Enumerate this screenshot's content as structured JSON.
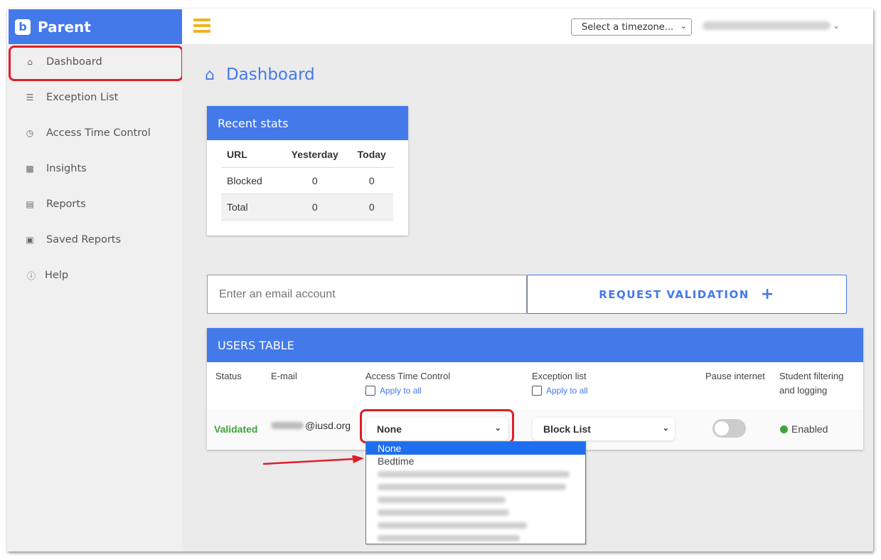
{
  "brand": {
    "logo": "b",
    "name": "Parent"
  },
  "sidebar": {
    "items": [
      {
        "label": "Dashboard",
        "icon": "home-icon"
      },
      {
        "label": "Exception List",
        "icon": "list-icon"
      },
      {
        "label": "Access Time Control",
        "icon": "clock-icon"
      },
      {
        "label": "Insights",
        "icon": "bar-chart-icon"
      },
      {
        "label": "Reports",
        "icon": "document-icon"
      },
      {
        "label": "Saved Reports",
        "icon": "saved-document-icon"
      },
      {
        "label": "Help",
        "icon": "question-circle-icon"
      }
    ]
  },
  "topbar": {
    "timezone_select": "Select a timezone..."
  },
  "page": {
    "title": "Dashboard"
  },
  "stats": {
    "title": "Recent stats",
    "headers": [
      "URL",
      "Yesterday",
      "Today"
    ],
    "rows": [
      [
        "Blocked",
        "0",
        "0"
      ],
      [
        "Total",
        "0",
        "0"
      ]
    ]
  },
  "validation": {
    "email_placeholder": "Enter an email account",
    "button_label": "REQUEST VALIDATION",
    "button_icon": "+"
  },
  "users_table": {
    "title": "USERS TABLE",
    "headers": {
      "status": "Status",
      "email": "E-mail",
      "atc": "Access Time Control",
      "exception": "Exception list",
      "pause": "Pause internet",
      "filtering": "Student filtering and logging"
    },
    "apply_all": "Apply to all",
    "row": {
      "status": "Validated",
      "email_domain": "@iusd.org",
      "atc_value": "None",
      "exception_value": "Block List",
      "filtering": "Enabled"
    }
  },
  "dropdown": {
    "options": [
      "None",
      "Bedtime"
    ]
  },
  "colors": {
    "brand_blue": "#4479ea",
    "accent_yellow": "#f0b221",
    "validated_green": "#3ea33e",
    "highlight_red": "#e01e2a",
    "option_selected": "#1e6ef0"
  }
}
